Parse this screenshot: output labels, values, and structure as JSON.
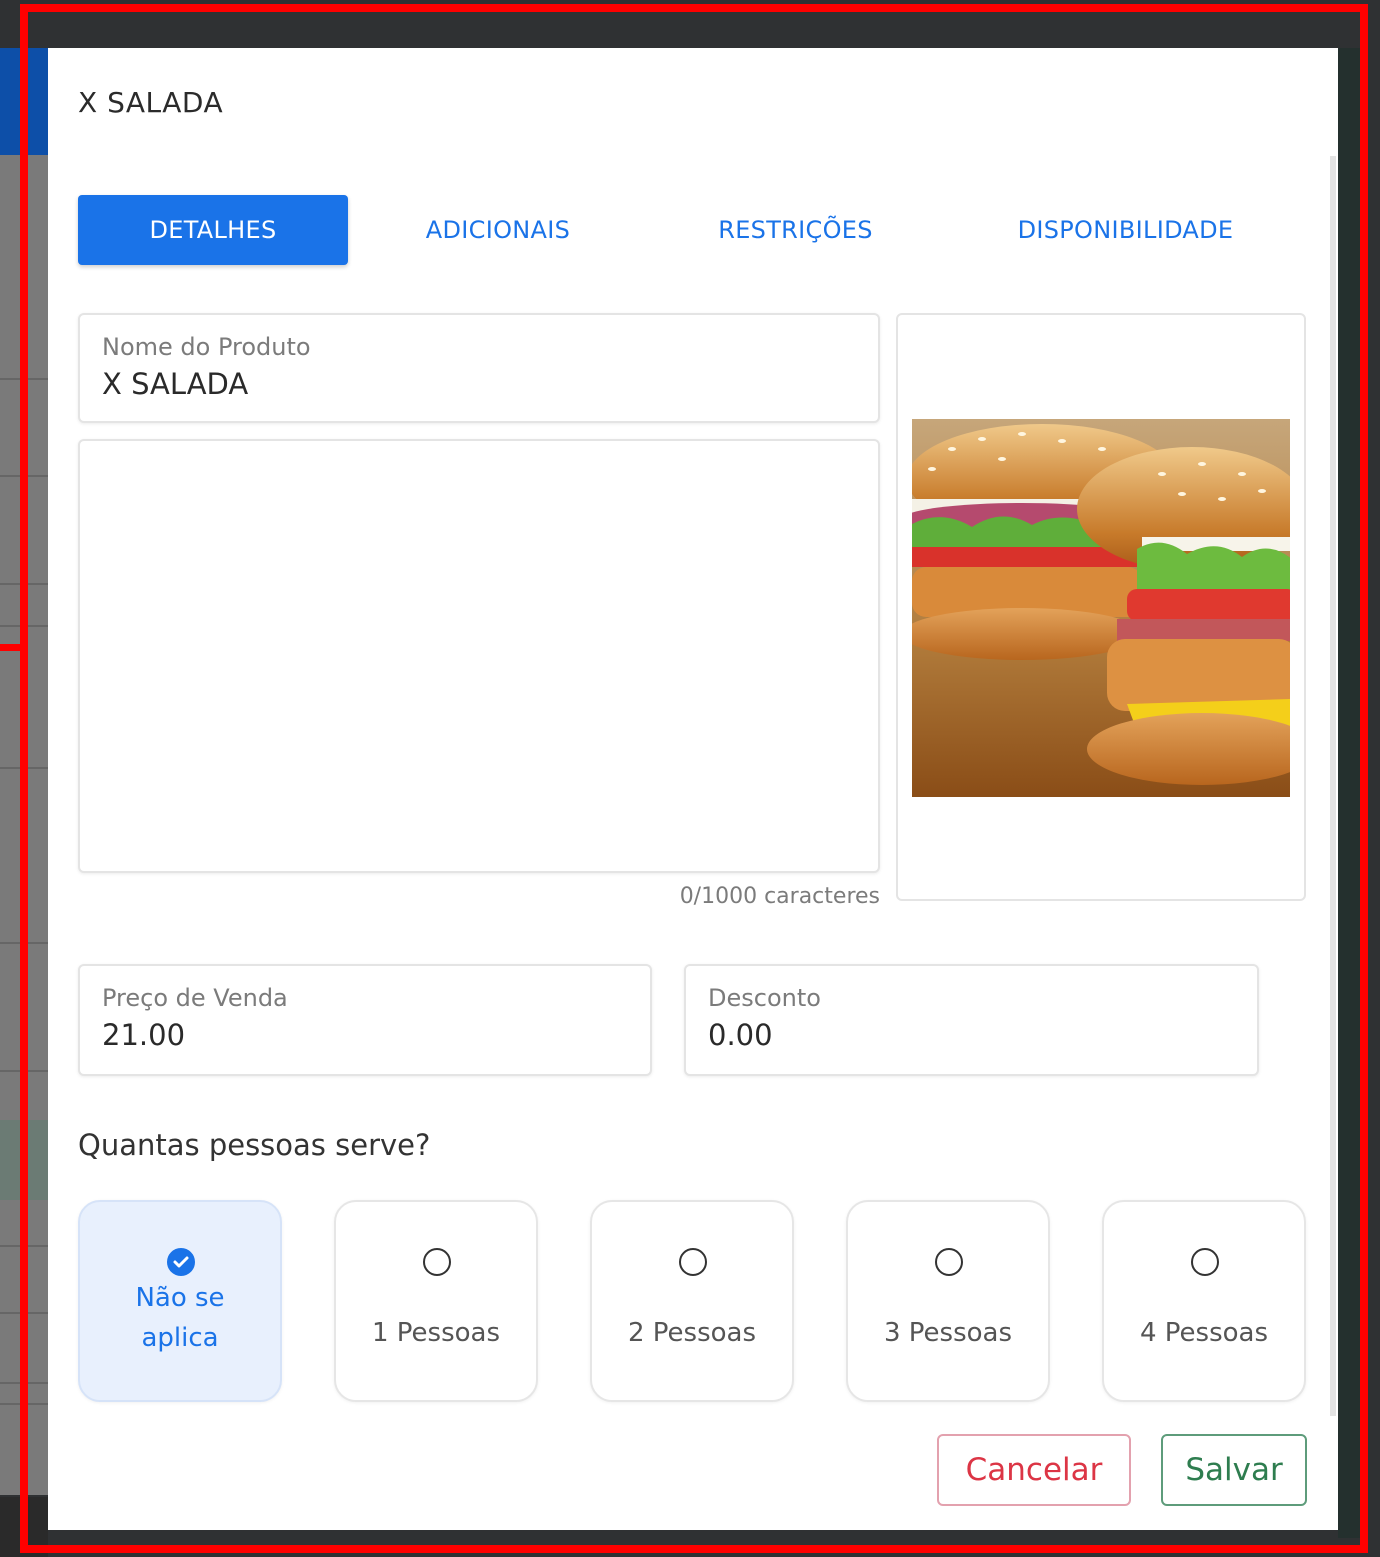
{
  "modal": {
    "title": "X SALADA"
  },
  "tabs": [
    {
      "label": "DETALHES",
      "active": true
    },
    {
      "label": "ADICIONAIS",
      "active": false
    },
    {
      "label": "RESTRIÇÕES",
      "active": false
    },
    {
      "label": "DISPONIBILIDADE",
      "active": false
    }
  ],
  "form": {
    "product_name": {
      "label": "Nome do Produto",
      "value": "X SALADA"
    },
    "description": {
      "value": "",
      "counter": "0/1000 caracteres"
    },
    "price": {
      "label": "Preço de Venda",
      "value": "21.00"
    },
    "discount": {
      "label": "Desconto",
      "value": "0.00"
    }
  },
  "image": {
    "icon": "burger-photo"
  },
  "servings": {
    "question": "Quantas pessoas serve?",
    "options": [
      {
        "label": "Não se aplica",
        "selected": true
      },
      {
        "label": "1 Pessoas",
        "selected": false
      },
      {
        "label": "2 Pessoas",
        "selected": false
      },
      {
        "label": "3 Pessoas",
        "selected": false
      },
      {
        "label": "4 Pessoas",
        "selected": false
      }
    ]
  },
  "actions": {
    "cancel_label": "Cancelar",
    "save_label": "Salvar"
  },
  "colors": {
    "primary": "#1a73e8",
    "danger": "#dc3545",
    "success": "#2e7d4f",
    "highlight": "#ff0000"
  }
}
